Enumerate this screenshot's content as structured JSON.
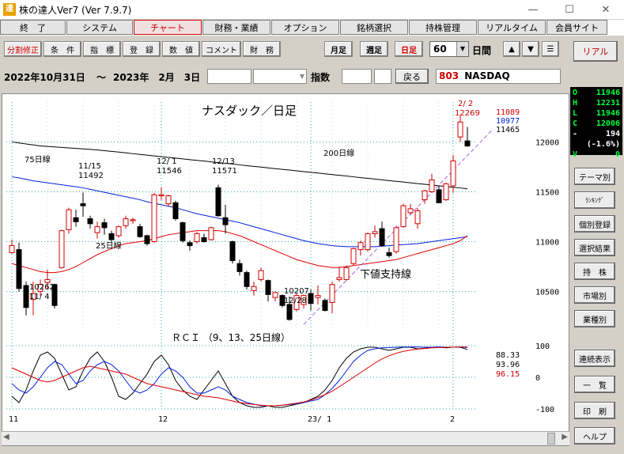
{
  "window": {
    "title": "株の達人Ver7 (Ver 7.9.7)",
    "icon": "達",
    "minimize": "—",
    "maximize": "☐",
    "close": "✕"
  },
  "menu": [
    "終　了",
    "システム",
    "チャート",
    "財務・業績",
    "オプション",
    "銘柄選択",
    "持株管理",
    "リアルタイム",
    "会員サイト"
  ],
  "toolbar": {
    "buttons": [
      "分割修正",
      "条　件",
      "指　標",
      "登　録",
      "数　値",
      "コメント",
      "財　務"
    ],
    "periods": [
      "月足",
      "週足",
      "日足"
    ],
    "count": "60",
    "count_unit": "日間",
    "up": "▲",
    "down": "▼",
    "menu_icon": "☰",
    "realtime": "リアル"
  },
  "datebar": {
    "from": "2022年10月31日",
    "tilde": "～",
    "to": "2023年　2月　3日",
    "index_label": "指数",
    "back": "戻る",
    "code": "803",
    "name": "NASDAQ"
  },
  "quote": [
    {
      "k": "O",
      "v": "11946"
    },
    {
      "k": "H",
      "v": "12231"
    },
    {
      "k": "L",
      "v": "11946"
    },
    {
      "k": "C",
      "v": "12006"
    },
    {
      "k": "-",
      "v": "194"
    },
    {
      "k": "",
      "v": "(-1.6%)"
    },
    {
      "k": "V",
      "v": "0"
    }
  ],
  "sidebar": [
    "テーマ別",
    "ﾗﾝｷﾝｸﾞ",
    "個別登録",
    "選択結果",
    "持　株",
    "市場別",
    "業種別",
    "連続表示",
    "一　覧",
    "印　刷",
    "ヘルプ"
  ],
  "chart_data": {
    "type": "candlestick",
    "title": "ナスダック／日足",
    "ylim": [
      10100,
      12400
    ],
    "yticks": [
      10500,
      11000,
      11500,
      12000
    ],
    "candles": [
      {
        "d": "11/1",
        "o": 10890,
        "h": 11020,
        "l": 10880,
        "c": 10960
      },
      {
        "d": "11/2",
        "o": 10920,
        "h": 10990,
        "l": 10500,
        "c": 10530
      },
      {
        "d": "11/3",
        "o": 10560,
        "h": 10600,
        "l": 10260,
        "c": 10340
      },
      {
        "d": "11/4",
        "o": 10420,
        "h": 10600,
        "l": 10262,
        "c": 10480
      },
      {
        "d": "11/7",
        "o": 10500,
        "h": 10620,
        "l": 10460,
        "c": 10570
      },
      {
        "d": "11/8",
        "o": 10590,
        "h": 10720,
        "l": 10520,
        "c": 10620
      },
      {
        "d": "11/9",
        "o": 10570,
        "h": 10580,
        "l": 10330,
        "c": 10360
      },
      {
        "d": "11/10",
        "o": 10740,
        "h": 11120,
        "l": 10730,
        "c": 11110
      },
      {
        "d": "11/11",
        "o": 11120,
        "h": 11340,
        "l": 11080,
        "c": 11320
      },
      {
        "d": "11/14",
        "o": 11240,
        "h": 11320,
        "l": 11150,
        "c": 11200
      },
      {
        "d": "11/15",
        "o": 11380,
        "h": 11492,
        "l": 11250,
        "c": 11360
      },
      {
        "d": "11/16",
        "o": 11230,
        "h": 11260,
        "l": 11130,
        "c": 11180
      },
      {
        "d": "11/17",
        "o": 11090,
        "h": 11200,
        "l": 11030,
        "c": 11150
      },
      {
        "d": "11/18",
        "o": 11190,
        "h": 11230,
        "l": 11070,
        "c": 11140
      },
      {
        "d": "11/21",
        "o": 11080,
        "h": 11110,
        "l": 11000,
        "c": 11020
      },
      {
        "d": "11/22",
        "o": 11060,
        "h": 11160,
        "l": 11040,
        "c": 11150
      },
      {
        "d": "11/23",
        "o": 11160,
        "h": 11260,
        "l": 11130,
        "c": 11230
      },
      {
        "d": "11/25",
        "o": 11210,
        "h": 11240,
        "l": 11180,
        "c": 11220
      },
      {
        "d": "11/28",
        "o": 11150,
        "h": 11180,
        "l": 11040,
        "c": 11050
      },
      {
        "d": "11/29",
        "o": 11060,
        "h": 11070,
        "l": 10960,
        "c": 10980
      },
      {
        "d": "11/30",
        "o": 11000,
        "h": 11490,
        "l": 10990,
        "c": 11470
      },
      {
        "d": "12/1",
        "o": 11460,
        "h": 11546,
        "l": 11420,
        "c": 11470
      },
      {
        "d": "12/2",
        "o": 11380,
        "h": 11470,
        "l": 11350,
        "c": 11460
      },
      {
        "d": "12/5",
        "o": 11390,
        "h": 11410,
        "l": 11210,
        "c": 11230
      },
      {
        "d": "12/6",
        "o": 11190,
        "h": 11200,
        "l": 10990,
        "c": 11010
      },
      {
        "d": "12/7",
        "o": 10990,
        "h": 11010,
        "l": 10910,
        "c": 10960
      },
      {
        "d": "12/8",
        "o": 11000,
        "h": 11100,
        "l": 10980,
        "c": 11080
      },
      {
        "d": "12/9",
        "o": 11040,
        "h": 11080,
        "l": 10990,
        "c": 11000
      },
      {
        "d": "12/12",
        "o": 11020,
        "h": 11150,
        "l": 11010,
        "c": 11140
      },
      {
        "d": "12/13",
        "o": 11540,
        "h": 11571,
        "l": 11250,
        "c": 11260
      },
      {
        "d": "12/14",
        "o": 11240,
        "h": 11370,
        "l": 11080,
        "c": 11170
      },
      {
        "d": "12/15",
        "o": 11000,
        "h": 11010,
        "l": 10780,
        "c": 10810
      },
      {
        "d": "12/16",
        "o": 10780,
        "h": 10820,
        "l": 10660,
        "c": 10700
      },
      {
        "d": "12/19",
        "o": 10690,
        "h": 10710,
        "l": 10520,
        "c": 10550
      },
      {
        "d": "12/20",
        "o": 10510,
        "h": 10600,
        "l": 10460,
        "c": 10550
      },
      {
        "d": "12/21",
        "o": 10620,
        "h": 10740,
        "l": 10600,
        "c": 10710
      },
      {
        "d": "12/22",
        "o": 10610,
        "h": 10620,
        "l": 10400,
        "c": 10470
      },
      {
        "d": "12/23",
        "o": 10440,
        "h": 10500,
        "l": 10400,
        "c": 10490
      },
      {
        "d": "12/27",
        "o": 10460,
        "h": 10470,
        "l": 10340,
        "c": 10360
      },
      {
        "d": "12/28",
        "o": 10370,
        "h": 10450,
        "l": 10207,
        "c": 10220
      },
      {
        "d": "12/29",
        "o": 10320,
        "h": 10480,
        "l": 10300,
        "c": 10460
      },
      {
        "d": "12/30",
        "o": 10370,
        "h": 10470,
        "l": 10330,
        "c": 10460
      },
      {
        "d": "1/3",
        "o": 10480,
        "h": 10520,
        "l": 10310,
        "c": 10380
      },
      {
        "d": "1/4",
        "o": 10440,
        "h": 10560,
        "l": 10370,
        "c": 10460
      },
      {
        "d": "1/5",
        "o": 10410,
        "h": 10430,
        "l": 10300,
        "c": 10310
      },
      {
        "d": "1/6",
        "o": 10390,
        "h": 10600,
        "l": 10280,
        "c": 10570
      },
      {
        "d": "1/9",
        "o": 10620,
        "h": 10750,
        "l": 10600,
        "c": 10640
      },
      {
        "d": "1/10",
        "o": 10620,
        "h": 10760,
        "l": 10610,
        "c": 10740
      },
      {
        "d": "1/11",
        "o": 10780,
        "h": 10940,
        "l": 10760,
        "c": 10930
      },
      {
        "d": "1/12",
        "o": 10920,
        "h": 11010,
        "l": 10860,
        "c": 10990
      },
      {
        "d": "1/13",
        "o": 10920,
        "h": 11090,
        "l": 10900,
        "c": 11080
      },
      {
        "d": "1/17",
        "o": 11080,
        "h": 11160,
        "l": 11040,
        "c": 11100
      },
      {
        "d": "1/18",
        "o": 11130,
        "h": 11200,
        "l": 10950,
        "c": 10960
      },
      {
        "d": "1/19",
        "o": 10890,
        "h": 10940,
        "l": 10840,
        "c": 10860
      },
      {
        "d": "1/20",
        "o": 10900,
        "h": 11160,
        "l": 10880,
        "c": 11140
      },
      {
        "d": "1/23",
        "o": 11150,
        "h": 11380,
        "l": 11140,
        "c": 11360
      },
      {
        "d": "1/24",
        "o": 11290,
        "h": 11380,
        "l": 11270,
        "c": 11330
      },
      {
        "d": "1/25",
        "o": 11180,
        "h": 11340,
        "l": 11130,
        "c": 11310
      },
      {
        "d": "1/26",
        "o": 11420,
        "h": 11520,
        "l": 11380,
        "c": 11510
      },
      {
        "d": "1/27",
        "o": 11500,
        "h": 11680,
        "l": 11490,
        "c": 11620
      },
      {
        "d": "1/30",
        "o": 11520,
        "h": 11560,
        "l": 11390,
        "c": 11390
      },
      {
        "d": "1/31",
        "o": 11420,
        "h": 11590,
        "l": 11410,
        "c": 11580
      },
      {
        "d": "2/1",
        "o": 11560,
        "h": 11870,
        "l": 11490,
        "c": 11810
      },
      {
        "d": "2/2",
        "o": 12050,
        "h": 12269,
        "l": 12000,
        "c": 12200
      },
      {
        "d": "2/3",
        "o": 12010,
        "h": 12150,
        "l": 11950,
        "c": 11960
      }
    ],
    "ma75": [
      11650,
      11640,
      11625,
      11610,
      11600,
      11590,
      11580,
      11570,
      11560,
      11550,
      11540,
      11525,
      11510,
      11495,
      11480,
      11465,
      11450,
      11435,
      11420,
      11400,
      11385,
      11370,
      11355,
      11340,
      11320,
      11300,
      11280,
      11265,
      11250,
      11235,
      11220,
      11205,
      11190,
      11170,
      11150,
      11130,
      11110,
      11090,
      11070,
      11050,
      11030,
      11010,
      10995,
      10980,
      10970,
      10960,
      10955,
      10950,
      10950,
      10950,
      10950,
      10950,
      10955,
      10960,
      10965,
      10970,
      10975,
      10980,
      10990,
      11000,
      11010,
      11020,
      11030,
      11040,
      11050
    ],
    "ma25": [
      10780,
      10760,
      10740,
      10720,
      10700,
      10690,
      10690,
      10700,
      10720,
      10750,
      10790,
      10830,
      10870,
      10900,
      10930,
      10960,
      10980,
      10990,
      11000,
      11010,
      11030,
      11050,
      11070,
      11080,
      11090,
      11100,
      11110,
      11110,
      11110,
      11110,
      11100,
      11080,
      11060,
      11030,
      11000,
      10970,
      10940,
      10910,
      10880,
      10850,
      10820,
      10800,
      10780,
      10760,
      10750,
      10740,
      10740,
      10750,
      10760,
      10770,
      10780,
      10790,
      10800,
      10810,
      10820,
      10840,
      10860,
      10880,
      10900,
      10920,
      10940,
      10960,
      10980,
      11010,
      11060
    ],
    "ma200": [
      12000,
      11990,
      11980,
      11970,
      11960,
      11955,
      11950,
      11945,
      11940,
      11935,
      11930,
      11925,
      11920,
      11912,
      11905,
      11898,
      11890,
      11882,
      11875,
      11868,
      11860,
      11852,
      11845,
      11838,
      11830,
      11822,
      11815,
      11808,
      11800,
      11792,
      11785,
      11778,
      11770,
      11762,
      11755,
      11748,
      11740,
      11732,
      11725,
      11718,
      11710,
      11702,
      11695,
      11688,
      11680,
      11672,
      11665,
      11658,
      11650,
      11642,
      11635,
      11628,
      11620,
      11612,
      11605,
      11598,
      11590,
      11582,
      11575,
      11568,
      11560,
      11552,
      11545,
      11538,
      11530
    ],
    "support_line": {
      "from": {
        "i": 41,
        "v": 10170
      },
      "to": {
        "i": 63,
        "v": 11940
      },
      "label": "下値支持線"
    },
    "labels": {
      "ma75": "75日線",
      "ma25": "25日線",
      "ma200": "200日線",
      "low1": {
        "i": 2,
        "price": "10262",
        "date": "11/ 4"
      },
      "high1": {
        "i": 10,
        "date": "11/15",
        "price": "11492"
      },
      "high2": {
        "i": 21,
        "date": "12/ 1",
        "price": "11546"
      },
      "high3": {
        "i": 29,
        "date": "12/13",
        "price": "11571"
      },
      "low2": {
        "i": 39,
        "price": "10207",
        "date": "12/28"
      },
      "high4": {
        "i": 63,
        "date": "2/ 2",
        "price": "12269"
      },
      "ma_values": [
        "11089",
        "10977",
        "11465"
      ]
    },
    "x_labels": [
      {
        "i": 0,
        "t": "11"
      },
      {
        "i": 21,
        "t": "12"
      },
      {
        "i": 42,
        "t": "23/ 1"
      },
      {
        "i": 62,
        "t": "2"
      }
    ],
    "rci": {
      "title": "ＲＣＩ （9、13、25日線）",
      "ylim": [
        -100,
        100
      ],
      "yticks": [
        100,
        0,
        -100
      ],
      "values": [
        "88.33",
        "93.96",
        "96.15"
      ],
      "rci9": [
        -60,
        -80,
        -40,
        20,
        70,
        80,
        60,
        10,
        -40,
        -30,
        20,
        60,
        80,
        50,
        0,
        -60,
        -70,
        -50,
        -20,
        10,
        50,
        70,
        40,
        -10,
        -40,
        -60,
        -70,
        -40,
        -10,
        20,
        -20,
        -60,
        -80,
        -90,
        -95,
        -95,
        -90,
        -95,
        -95,
        -90,
        -85,
        -80,
        -70,
        -60,
        -40,
        -10,
        30,
        60,
        80,
        90,
        95,
        95,
        90,
        85,
        90,
        95,
        95,
        90,
        92,
        95,
        95,
        93,
        95,
        95,
        88
      ],
      "rci13": [
        -20,
        -40,
        -50,
        -30,
        0,
        30,
        50,
        40,
        10,
        -20,
        -10,
        20,
        40,
        50,
        40,
        20,
        -10,
        -40,
        -50,
        -40,
        -20,
        10,
        30,
        20,
        0,
        -30,
        -50,
        -50,
        -40,
        -30,
        -40,
        -60,
        -70,
        -80,
        -85,
        -90,
        -90,
        -90,
        -88,
        -86,
        -84,
        -80,
        -75,
        -70,
        -55,
        -35,
        -10,
        20,
        50,
        70,
        85,
        90,
        93,
        94,
        95,
        96,
        96,
        96,
        95,
        95,
        96,
        95,
        95,
        96,
        94
      ],
      "rci25": [
        30,
        20,
        10,
        0,
        -10,
        -15,
        -10,
        0,
        10,
        20,
        30,
        35,
        30,
        25,
        20,
        15,
        10,
        0,
        -10,
        -20,
        -25,
        -30,
        -35,
        -40,
        -45,
        -50,
        -55,
        -60,
        -62,
        -65,
        -70,
        -75,
        -80,
        -83,
        -86,
        -88,
        -90,
        -90,
        -88,
        -85,
        -82,
        -78,
        -72,
        -64,
        -55,
        -44,
        -30,
        -15,
        0,
        15,
        30,
        45,
        58,
        68,
        76,
        82,
        86,
        89,
        91,
        93,
        94,
        95,
        95,
        96,
        96
      ]
    }
  }
}
